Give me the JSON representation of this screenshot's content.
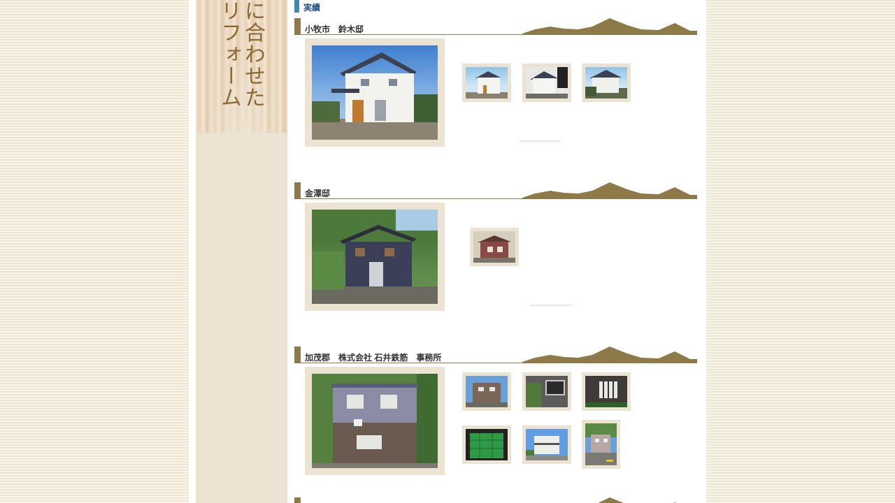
{
  "sidebar": {
    "vertical_text_right": "に合わせた",
    "vertical_text_left": "リフォーム"
  },
  "page": {
    "heading": "実績"
  },
  "sections": [
    {
      "title": "小牧市　鈴木邸"
    },
    {
      "title": "金澤邸"
    },
    {
      "title": "加茂郡　株式会社 石井鉄筋　事務所"
    }
  ],
  "colors": {
    "accent_blue": "#3b87b5",
    "section_bar": "#8d7a48",
    "frame": "#ede3d3"
  }
}
